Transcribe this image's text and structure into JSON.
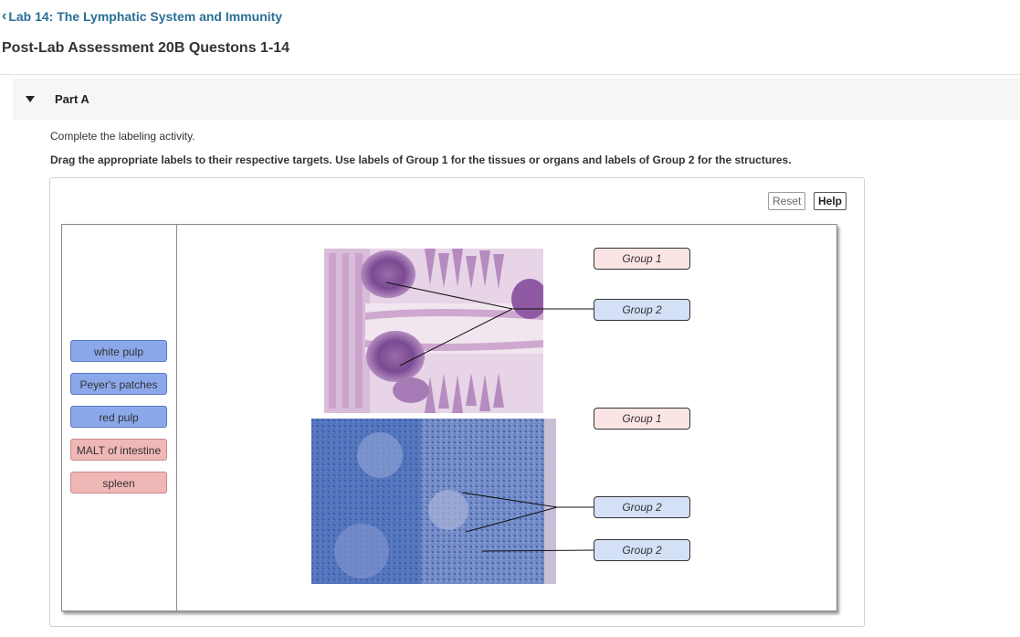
{
  "breadcrumb": {
    "label": "Lab 14: The Lymphatic System and Immunity"
  },
  "page_title": "Post-Lab Assessment 20B Questons 1-14",
  "part": {
    "label": "Part A"
  },
  "instructions": {
    "line1": "Complete the labeling activity.",
    "line2": "Drag the appropriate labels to their respective targets. Use labels of Group 1 for the tissues or organs and labels of Group 2 for the structures."
  },
  "toolbar": {
    "reset_label": "Reset",
    "help_label": "Help"
  },
  "labels": [
    {
      "text": "white pulp",
      "group": 2
    },
    {
      "text": "Peyer's patches",
      "group": 2
    },
    {
      "text": "red pulp",
      "group": 2
    },
    {
      "text": "MALT of intestine",
      "group": 1
    },
    {
      "text": "spleen",
      "group": 1
    }
  ],
  "targets": [
    {
      "text": "Group 1"
    },
    {
      "text": "Group 2"
    },
    {
      "text": "Group 1"
    },
    {
      "text": "Group 2"
    },
    {
      "text": "Group 2"
    }
  ],
  "colors": {
    "group1_chip": "#f0b7b7",
    "group2_chip": "#8ba8ea",
    "group1_target": "#fbe4e4",
    "group2_target": "#d4e0f6",
    "link": "#2a6f97"
  }
}
